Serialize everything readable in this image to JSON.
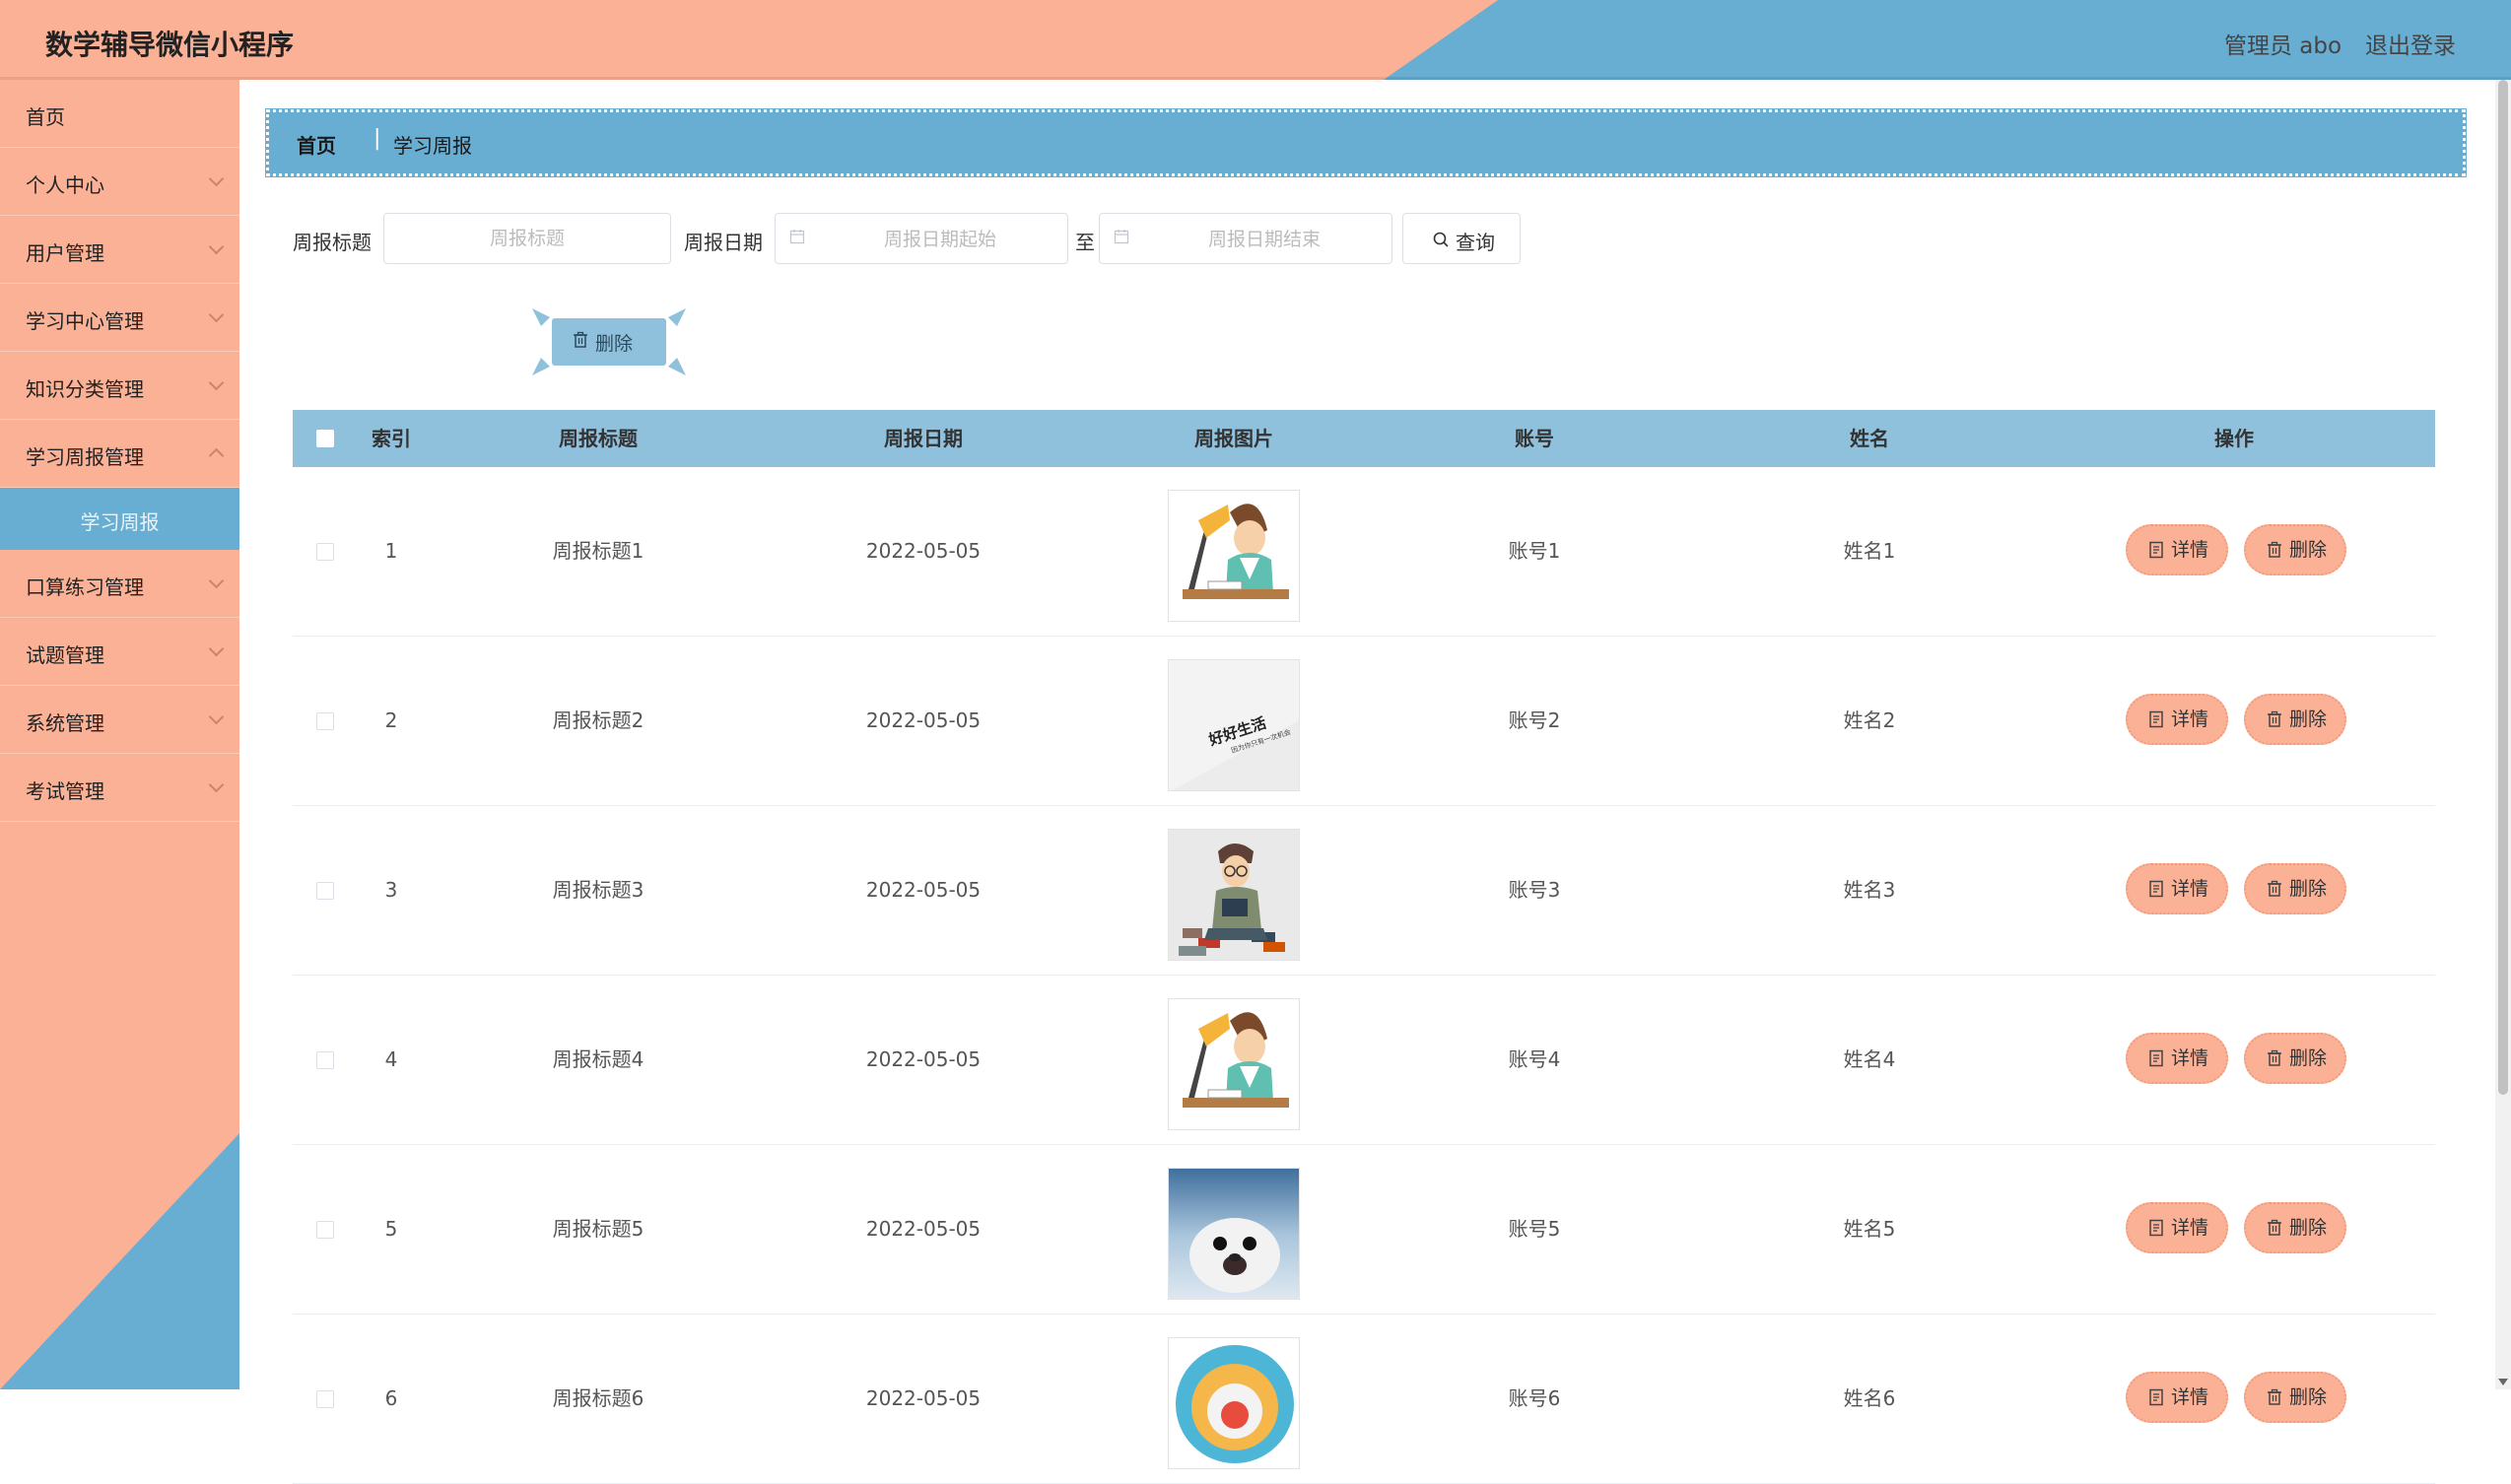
{
  "header": {
    "title": "数学辅导微信小程序",
    "admin_label": "管理员 abo",
    "logout": "退出登录"
  },
  "sidebar": {
    "items": [
      {
        "label": "首页",
        "expandable": false
      },
      {
        "label": "个人中心",
        "expandable": true
      },
      {
        "label": "用户管理",
        "expandable": true
      },
      {
        "label": "学习中心管理",
        "expandable": true
      },
      {
        "label": "知识分类管理",
        "expandable": true
      },
      {
        "label": "学习周报管理",
        "expandable": true,
        "expanded": true
      },
      {
        "label": "口算练习管理",
        "expandable": true
      },
      {
        "label": "试题管理",
        "expandable": true
      },
      {
        "label": "系统管理",
        "expandable": true
      },
      {
        "label": "考试管理",
        "expandable": true
      }
    ],
    "active_sub": "学习周报"
  },
  "breadcrumb": {
    "home": "首页",
    "separator": "|",
    "current": "学习周报"
  },
  "search": {
    "title_label": "周报标题",
    "title_placeholder": "周报标题",
    "date_label": "周报日期",
    "date_start_placeholder": "周报日期起始",
    "to": "至",
    "date_end_placeholder": "周报日期结束",
    "query_button": "查询"
  },
  "toolbar": {
    "delete_button": "删除"
  },
  "table": {
    "headers": [
      "索引",
      "周报标题",
      "周报日期",
      "周报图片",
      "账号",
      "姓名",
      "操作"
    ],
    "rows": [
      {
        "index": "1",
        "title": "周报标题1",
        "date": "2022-05-05",
        "image": "student-desk-lamp",
        "account": "账号1",
        "name": "姓名1"
      },
      {
        "index": "2",
        "title": "周报标题2",
        "date": "2022-05-05",
        "image": "good-life-text",
        "account": "账号2",
        "name": "姓名2"
      },
      {
        "index": "3",
        "title": "周报标题3",
        "date": "2022-05-05",
        "image": "reading-man",
        "account": "账号3",
        "name": "姓名3"
      },
      {
        "index": "4",
        "title": "周报标题4",
        "date": "2022-05-05",
        "image": "student-desk-lamp",
        "account": "账号4",
        "name": "姓名4"
      },
      {
        "index": "5",
        "title": "周报标题5",
        "date": "2022-05-05",
        "image": "baby-seal",
        "account": "账号5",
        "name": "姓名5"
      },
      {
        "index": "6",
        "title": "周报标题6",
        "date": "2022-05-05",
        "image": "circle-chart",
        "account": "账号6",
        "name": "姓名6"
      }
    ],
    "detail_button": "详情",
    "delete_button": "删除"
  },
  "image_text": {
    "good_life": "好好生活",
    "good_life_sub": "因为你只有一次机会"
  },
  "colors": {
    "salmon": "#fbb196",
    "blue": "#68aed3",
    "table_header": "#8fc0dc"
  }
}
